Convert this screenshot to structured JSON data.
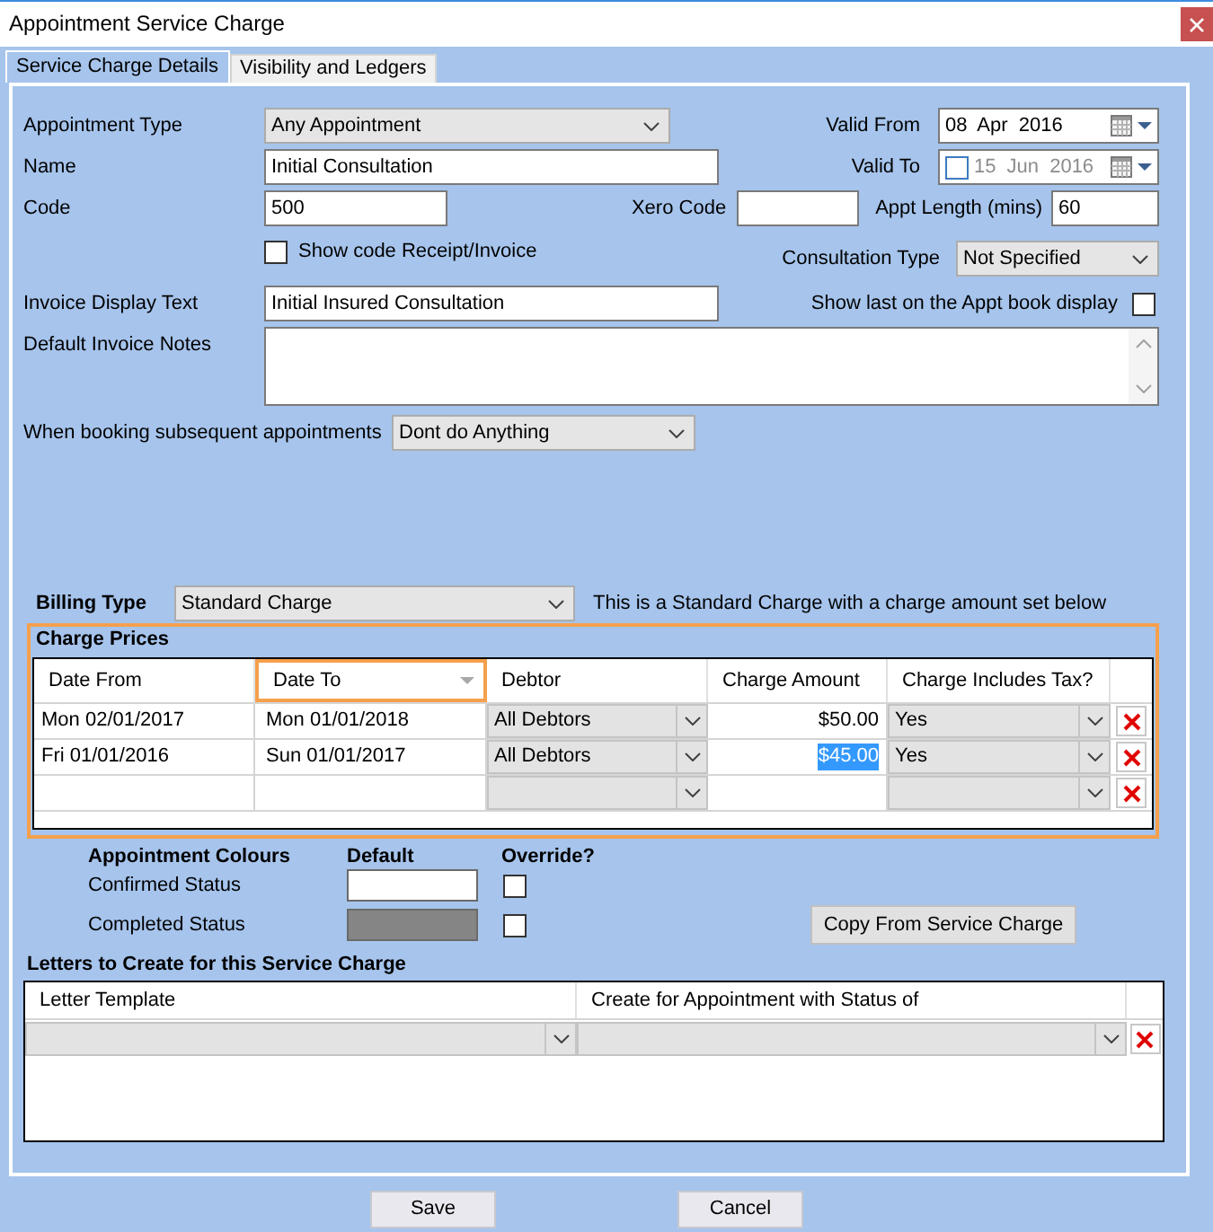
{
  "window": {
    "title": "Appointment Service Charge"
  },
  "tabs": [
    {
      "label": "Service Charge Details",
      "selected": true
    },
    {
      "label": "Visibility and Ledgers",
      "selected": false
    }
  ],
  "form": {
    "appointment_type": {
      "label": "Appointment Type",
      "value": "Any Appointment"
    },
    "valid_from": {
      "label": "Valid From",
      "value": "08 Apr 2016"
    },
    "name": {
      "label": "Name",
      "value": "Initial Consultation"
    },
    "valid_to": {
      "label": "Valid To",
      "value": "15 Jun 2016",
      "checked": false
    },
    "code": {
      "label": "Code",
      "value": "500"
    },
    "xero_code": {
      "label": "Xero Code"
    },
    "appt_length": {
      "label": "Appt Length (mins)",
      "value": "60"
    },
    "show_code": {
      "label": "Show code Receipt/Invoice",
      "checked": false
    },
    "consultation_type": {
      "label": "Consultation Type",
      "value": "Not Specified"
    },
    "invoice_display_text": {
      "label": "Invoice Display Text",
      "value": "Initial Insured Consultation"
    },
    "show_last": {
      "label": "Show last on the Appt book display",
      "checked": false
    },
    "default_invoice_notes": {
      "label": "Default Invoice Notes"
    },
    "subsequent_booking": {
      "label": "When booking subsequent appointments",
      "value": "Dont do Anything"
    }
  },
  "billing_type": {
    "label": "Billing Type",
    "value": "Standard Charge",
    "note": "This is a Standard Charge with a charge amount set below"
  },
  "charge_prices": {
    "title": "Charge Prices",
    "columns": [
      {
        "label": "Date From",
        "selected": false
      },
      {
        "label": "Date To",
        "selected": true
      },
      {
        "label": "Debtor",
        "selected": false
      },
      {
        "label": "Charge Amount",
        "selected": false
      },
      {
        "label": "Charge Includes Tax?",
        "selected": false
      }
    ],
    "rows": [
      {
        "kind": "entry",
        "date_from": "Mon 02/01/2017",
        "date_to": "Mon 01/01/2018",
        "debtor": "All Debtors",
        "amount": {
          "text": "$50.00",
          "selected": false
        },
        "includes_tax": "Yes"
      },
      {
        "kind": "entry",
        "date_from": "Fri 01/01/2016",
        "date_to": "Sun 01/01/2017",
        "debtor": "All Debtors",
        "amount": {
          "text": "$45.00",
          "selected": true
        },
        "includes_tax": "Yes"
      },
      {
        "kind": "new"
      }
    ]
  },
  "appointment_colours": {
    "title": "Appointment Colours",
    "default_heading": "Default",
    "override_heading": "Override?",
    "rows": [
      {
        "label": "Confirmed Status",
        "color": "#ffffff",
        "override": false
      },
      {
        "label": "Completed Status",
        "color": "#858585",
        "override": false
      }
    ],
    "copy_button": "Copy From Service Charge"
  },
  "letters": {
    "title": "Letters to Create for this Service Charge",
    "columns": [
      "Letter Template",
      "Create for Appointment with Status of"
    ],
    "rows": [
      {
        "kind": "new"
      }
    ]
  },
  "buttons": [
    "Save",
    "Cancel"
  ]
}
